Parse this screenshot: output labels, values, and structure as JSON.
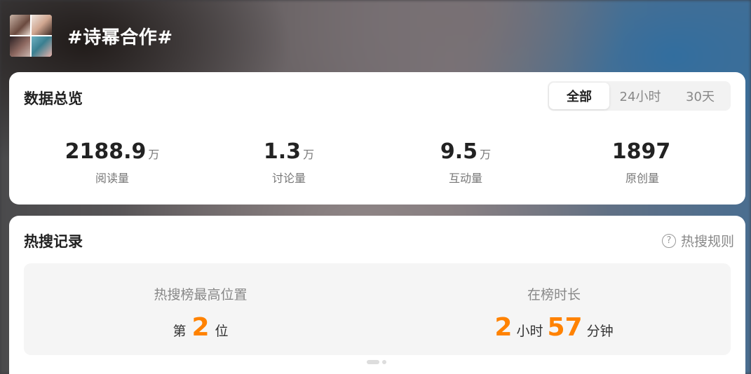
{
  "topic": {
    "title": "#诗幂合作#"
  },
  "overview": {
    "title": "数据总览",
    "tabs": [
      {
        "label": "全部",
        "active": true
      },
      {
        "label": "24小时",
        "active": false
      },
      {
        "label": "30天",
        "active": false
      }
    ],
    "stats": [
      {
        "value": "2188.9",
        "unit": "万",
        "label": "阅读量"
      },
      {
        "value": "1.3",
        "unit": "万",
        "label": "讨论量"
      },
      {
        "value": "9.5",
        "unit": "万",
        "label": "互动量"
      },
      {
        "value": "1897",
        "unit": "",
        "label": "原创量"
      }
    ]
  },
  "hot_search": {
    "title": "热搜记录",
    "rules_label": "热搜规则",
    "rules_icon": "question-circle-icon",
    "peak": {
      "label": "热搜榜最高位置",
      "prefix": "第",
      "value": "2",
      "suffix": "位"
    },
    "duration": {
      "label": "在榜时长",
      "hours": "2",
      "hours_unit": "小时",
      "minutes": "57",
      "minutes_unit": "分钟"
    }
  },
  "colors": {
    "accent": "#ff8200",
    "text": "#222222",
    "muted": "#888888"
  }
}
